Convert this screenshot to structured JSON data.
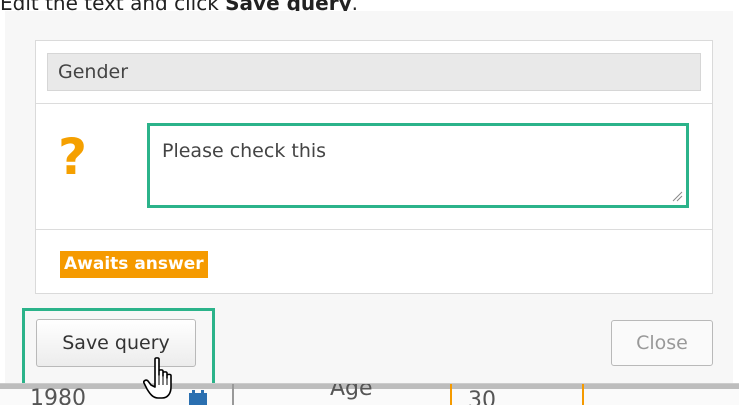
{
  "instruction": {
    "prefix": "Edit the text and click ",
    "action": "Save query",
    "suffix": "."
  },
  "query": {
    "field_label": "Gender",
    "icon": "question-mark-icon",
    "comment_text": "Please check this",
    "status": "Awaits answer"
  },
  "buttons": {
    "save_label": "Save query",
    "close_label": "Close"
  },
  "background_table": {
    "cells": [
      "1980",
      "Age",
      "30"
    ]
  },
  "colors": {
    "highlight": "#2bb38a",
    "accent_orange": "#f59a00",
    "question_mark": "#f5a000"
  }
}
